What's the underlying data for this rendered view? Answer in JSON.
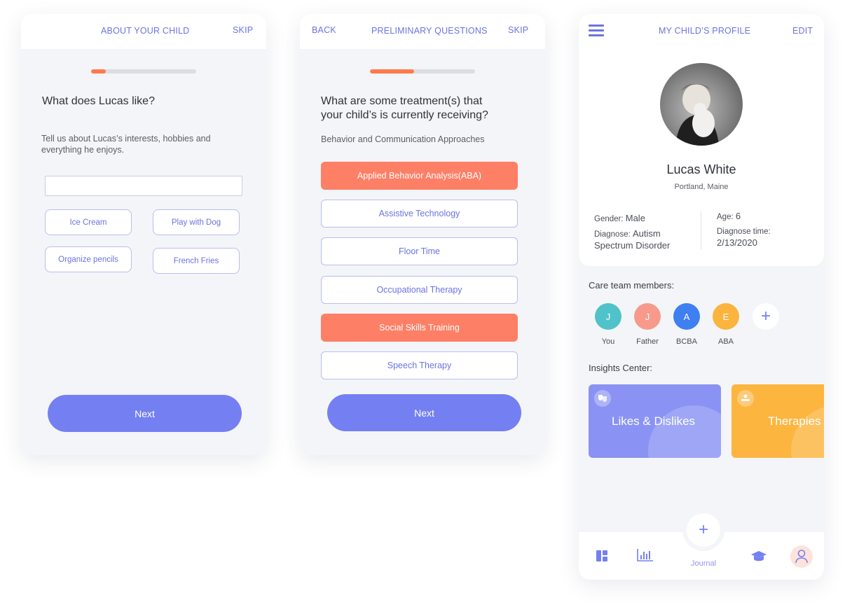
{
  "screen1": {
    "header": {
      "title": "ABOUT YOUR CHILD",
      "skip": "SKIP"
    },
    "progress": 0.14,
    "question": "What does Lucas like?",
    "subtitle_line1": "Tell us about Lucas’s interests, hobbies and",
    "subtitle_line2": "everything he enjoys.",
    "input_value": "",
    "chips": [
      "Ice Cream",
      "Play with Dog",
      "Organize pencils",
      "French Fries"
    ],
    "next": "Next"
  },
  "screen2": {
    "header": {
      "back": "BACK",
      "title": "PRELIMINARY QUESTIONS",
      "skip": "SKIP"
    },
    "progress": 0.42,
    "question_line1": "What are some treatment(s) that",
    "question_line2": "your child’s is currently receiving?",
    "subtitle": "Behavior and Communication Approaches",
    "options": [
      {
        "label": "Applied Behavior Analysis(ABA)",
        "selected": true
      },
      {
        "label": "Assistive Technology",
        "selected": false
      },
      {
        "label": "Floor Time",
        "selected": false
      },
      {
        "label": "Occupational Therapy",
        "selected": false
      },
      {
        "label": "Social Skills Training",
        "selected": true
      },
      {
        "label": "Speech Therapy",
        "selected": false
      }
    ],
    "next": "Next"
  },
  "screen3": {
    "header": {
      "title": "MY CHILD’S PROFILE",
      "edit": "EDIT",
      "menu_icon": "hamburger-icon"
    },
    "child": {
      "name": "Lucas White",
      "location": "Portland, Maine",
      "gender_label": "Gender: ",
      "gender": "Male",
      "diagnose_label": "Diagnose: ",
      "diagnose_line1": "Autism",
      "diagnose_line2": "Spectrum Disorder",
      "age_label": "Age: ",
      "age": "6",
      "diagnose_time_label": "Diagnose time:",
      "diagnose_time": "2/13/2020"
    },
    "care_team_title": "Care team members:",
    "members": [
      {
        "initial": "J",
        "name": "You",
        "color": "#4fc3c9"
      },
      {
        "initial": "J",
        "name": "Father",
        "color": "#f79a8c"
      },
      {
        "initial": "A",
        "name": "BCBA",
        "color": "#3e7ff2"
      },
      {
        "initial": "E",
        "name": "ABA",
        "color": "#fbb43e"
      }
    ],
    "add_member": "+",
    "insights_title": "Insights Center:",
    "insights": [
      {
        "label": "Likes & Dislikes",
        "color": "#8a93f3",
        "icon": "mask-icon"
      },
      {
        "label": "Therapies",
        "color": "#fcb53f",
        "icon": "therapist-icon"
      }
    ],
    "nav": {
      "journal_plus": "+",
      "journal_label": "Journal"
    }
  }
}
